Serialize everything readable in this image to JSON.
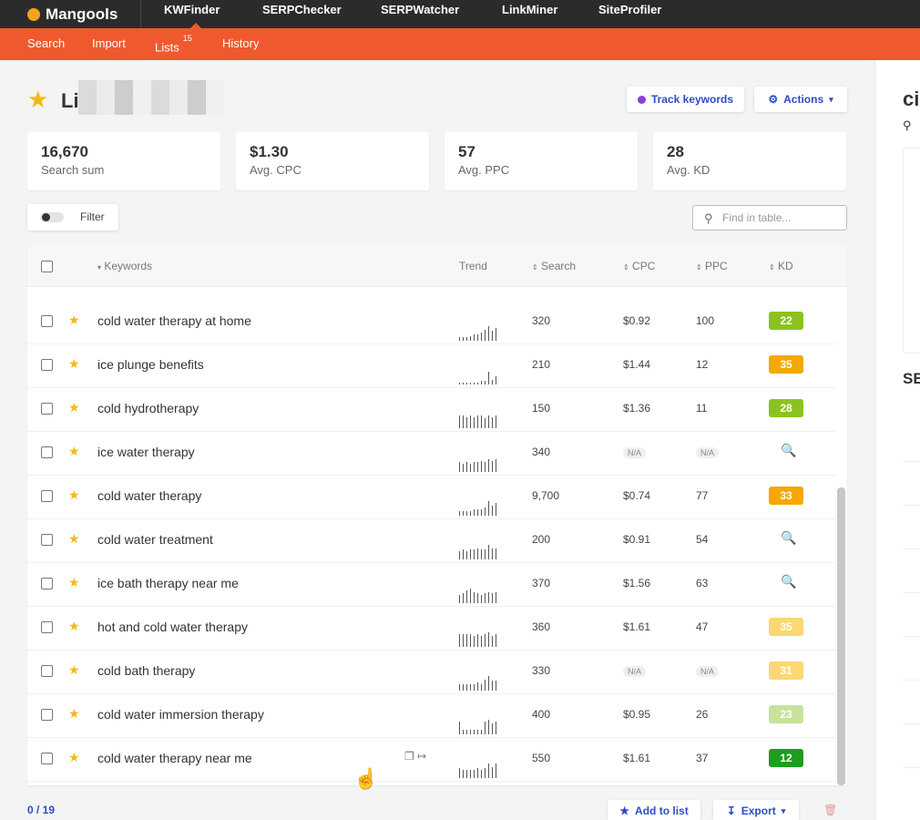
{
  "brand": {
    "name": "Mangools"
  },
  "apps": [
    {
      "label": "KWFinder",
      "active": true
    },
    {
      "label": "SERPChecker"
    },
    {
      "label": "SERPWatcher"
    },
    {
      "label": "LinkMiner"
    },
    {
      "label": "SiteProfiler"
    }
  ],
  "subnav": {
    "search": "Search",
    "import": "Import",
    "lists": "Lists",
    "lists_count": "15",
    "history": "History"
  },
  "header": {
    "title_prefix": "Li",
    "track_label": "Track keywords",
    "actions_label": "Actions"
  },
  "stats": [
    {
      "value": "16,670",
      "label": "Search sum"
    },
    {
      "value": "$1.30",
      "label": "Avg. CPC"
    },
    {
      "value": "57",
      "label": "Avg. PPC"
    },
    {
      "value": "28",
      "label": "Avg. KD"
    }
  ],
  "filter": {
    "label": "Filter",
    "enabled": false
  },
  "find": {
    "placeholder": "Find in table..."
  },
  "table": {
    "columns": {
      "keywords": "Keywords",
      "trend": "Trend",
      "search": "Search",
      "cpc": "CPC",
      "ppc": "PPC",
      "kd": "KD"
    },
    "rows": [
      {
        "keyword": "cold water therapy at home",
        "search": "320",
        "cpc": "$0.92",
        "ppc": "100",
        "kd": "22",
        "kd_color": "#8cc21f",
        "trend": [
          2,
          2,
          2,
          3,
          4,
          4,
          5,
          7,
          9,
          6,
          8
        ]
      },
      {
        "keyword": "ice plunge benefits",
        "search": "210",
        "cpc": "$1.44",
        "ppc": "12",
        "kd": "35",
        "kd_color": "#f5a800",
        "trend": [
          1,
          1,
          1,
          1,
          1,
          1,
          2,
          2,
          8,
          3,
          5
        ]
      },
      {
        "keyword": "cold hydrotherapy",
        "search": "150",
        "cpc": "$1.36",
        "ppc": "11",
        "kd": "28",
        "kd_color": "#8cc21f",
        "trend": [
          8,
          8,
          7,
          8,
          7,
          8,
          8,
          6,
          8,
          7,
          8
        ]
      },
      {
        "keyword": "ice water therapy",
        "search": "340",
        "cpc": "N/A",
        "ppc": "N/A",
        "kd": "",
        "kd_color": "",
        "trend": [
          6,
          5,
          6,
          5,
          6,
          6,
          7,
          6,
          8,
          7,
          8
        ]
      },
      {
        "keyword": "cold water therapy",
        "search": "9,700",
        "cpc": "$0.74",
        "ppc": "77",
        "kd": "33",
        "kd_color": "#f5a800",
        "trend": [
          3,
          3,
          3,
          3,
          4,
          4,
          4,
          5,
          9,
          6,
          8
        ]
      },
      {
        "keyword": "cold water treatment",
        "search": "200",
        "cpc": "$0.91",
        "ppc": "54",
        "kd": "",
        "kd_color": "",
        "trend": [
          5,
          6,
          5,
          6,
          6,
          7,
          6,
          6,
          9,
          7,
          7
        ]
      },
      {
        "keyword": "ice bath therapy near me",
        "search": "370",
        "cpc": "$1.56",
        "ppc": "63",
        "kd": "",
        "kd_color": "",
        "trend": [
          5,
          6,
          8,
          9,
          7,
          6,
          5,
          6,
          7,
          6,
          7
        ]
      },
      {
        "keyword": "hot and cold water therapy",
        "search": "360",
        "cpc": "$1.61",
        "ppc": "47",
        "kd": "35",
        "kd_color": "#fbd873",
        "trend": [
          8,
          8,
          8,
          8,
          7,
          8,
          7,
          8,
          9,
          7,
          8
        ]
      },
      {
        "keyword": "cold bath therapy",
        "search": "330",
        "cpc": "N/A",
        "ppc": "N/A",
        "kd": "31",
        "kd_color": "#fbd873",
        "trend": [
          4,
          4,
          4,
          4,
          4,
          5,
          4,
          7,
          9,
          6,
          6
        ]
      },
      {
        "keyword": "cold water immersion therapy",
        "search": "400",
        "cpc": "$0.95",
        "ppc": "26",
        "kd": "23",
        "kd_color": "#c8e29a",
        "trend": [
          8,
          3,
          3,
          3,
          3,
          3,
          3,
          8,
          9,
          7,
          8
        ]
      },
      {
        "keyword": "cold water therapy near me",
        "search": "550",
        "cpc": "$1.61",
        "ppc": "37",
        "kd": "12",
        "kd_color": "#1e9e1e",
        "trend": [
          6,
          5,
          5,
          5,
          5,
          6,
          5,
          6,
          9,
          7,
          9
        ]
      }
    ]
  },
  "footer": {
    "count": "0 / 19",
    "add_to_list": "Add to list",
    "export": "Export"
  },
  "right_panel": {
    "title": "ci",
    "se_label": "SE"
  },
  "colors": {
    "accent": "#ee5a2d",
    "topbar": "#2b2b2b",
    "link": "#2d4bc8",
    "star": "#f5b914"
  }
}
